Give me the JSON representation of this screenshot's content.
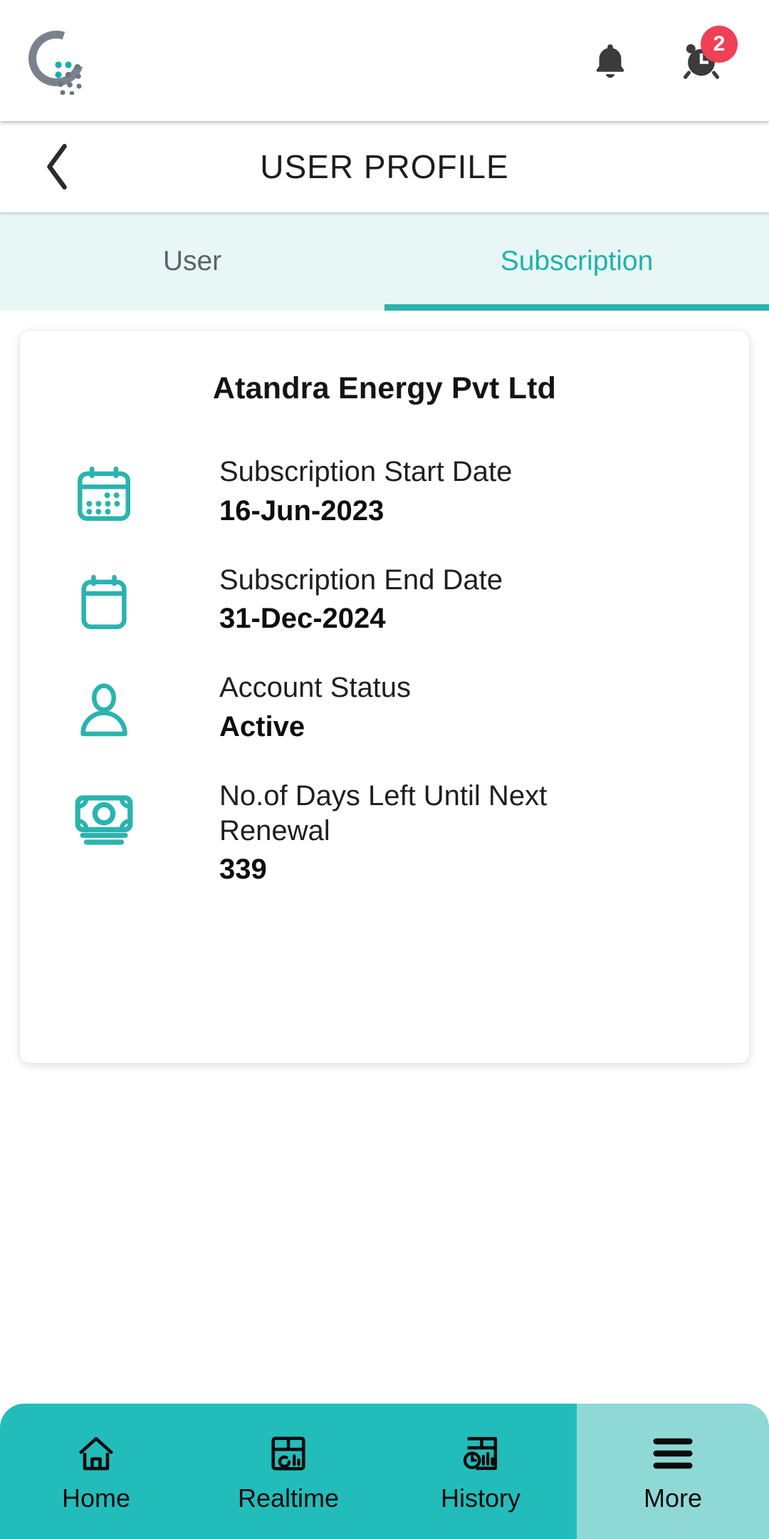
{
  "topbar": {
    "logo_name": "app-logo",
    "logo_ring_color": "#7b828c",
    "logo_dot_accent": "#18b0ab",
    "notifications_icon": "bell-icon",
    "alarm_icon": "alarm-clock-icon",
    "alarm_badge_count": "2",
    "badge_color": "#ef4056"
  },
  "header": {
    "back_icon": "chevron-left-icon",
    "title": "USER PROFILE"
  },
  "tabs": {
    "accent_color": "#2cb3ae",
    "background": "#e8f7f6",
    "items": [
      {
        "label": "User",
        "active": false
      },
      {
        "label": "Subscription",
        "active": true
      }
    ]
  },
  "card": {
    "title": "Atandra Energy Pvt Ltd",
    "icon_color": "#2cb3ae",
    "rows": [
      {
        "icon": "calendar-dots-icon",
        "label": "Subscription Start Date",
        "value": "16-Jun-2023"
      },
      {
        "icon": "calendar-blank-icon",
        "label": "Subscription End Date",
        "value": "31-Dec-2024"
      },
      {
        "icon": "user-person-icon",
        "label": "Account Status",
        "value": "Active"
      },
      {
        "icon": "banknote-money-icon",
        "label": "No.of Days Left Until Next Renewal",
        "value": "339"
      }
    ]
  },
  "bottomnav": {
    "background": "#22bcbb",
    "active_background": "#8ed9d6",
    "items": [
      {
        "label": "Home",
        "icon": "home-icon",
        "active": false
      },
      {
        "label": "Realtime",
        "icon": "realtime-dashboard-icon",
        "active": false
      },
      {
        "label": "History",
        "icon": "history-chart-icon",
        "active": false
      },
      {
        "label": "More",
        "icon": "hamburger-menu-icon",
        "active": true
      }
    ]
  }
}
